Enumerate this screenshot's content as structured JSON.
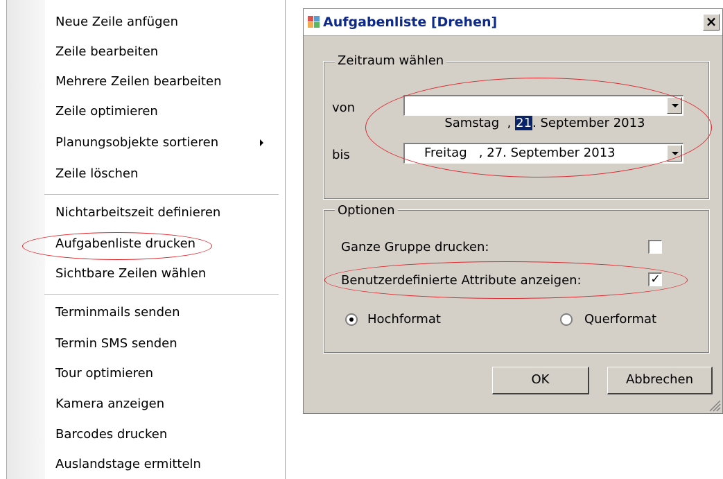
{
  "context_menu": {
    "items": [
      {
        "label": "Neue Zeile anfügen"
      },
      {
        "label": "Zeile bearbeiten"
      },
      {
        "label": "Mehrere Zeilen bearbeiten"
      },
      {
        "label": "Zeile optimieren"
      },
      {
        "label": "Planungsobjekte sortieren",
        "has_submenu": true
      },
      {
        "label": "Zeile löschen"
      },
      {
        "label": "Nichtarbeitszeit definieren"
      },
      {
        "label": "Aufgabenliste drucken",
        "highlighted": true
      },
      {
        "label": "Sichtbare Zeilen wählen"
      },
      {
        "label": "Terminmails senden"
      },
      {
        "label": "Termin SMS senden"
      },
      {
        "label": "Tour optimieren"
      },
      {
        "label": "Kamera anzeigen"
      },
      {
        "label": "Barcodes drucken"
      },
      {
        "label": "Auslandstage ermitteln"
      }
    ]
  },
  "dialog": {
    "title": "Aufgabenliste [Drehen]",
    "close_label": "×",
    "zeitraum": {
      "legend": "Zeitraum wählen",
      "von_label": "von",
      "von_weekday": "Samstag",
      "von_sep": "  , ",
      "von_day": "21",
      "von_rest": ". September 2013",
      "bis_label": "bis",
      "bis_value": "Freitag   , 27. September 2013"
    },
    "optionen": {
      "legend": "Optionen",
      "ganze_gruppe_label": "Ganze Gruppe drucken:",
      "ganze_gruppe_checked": false,
      "attribute_label": "Benutzerdefinierte Attribute anzeigen:",
      "attribute_checked": true,
      "check_mark": "✓",
      "hochformat_label": "Hochformat",
      "hochformat_selected": true,
      "querformat_label": "Querformat",
      "querformat_selected": false
    },
    "ok_label": "OK",
    "cancel_label": "Abbrechen"
  },
  "colors": {
    "annotation_red": "#e0242a",
    "title_blue": "#0d2a8a",
    "dialog_face": "#d4d0c8"
  }
}
